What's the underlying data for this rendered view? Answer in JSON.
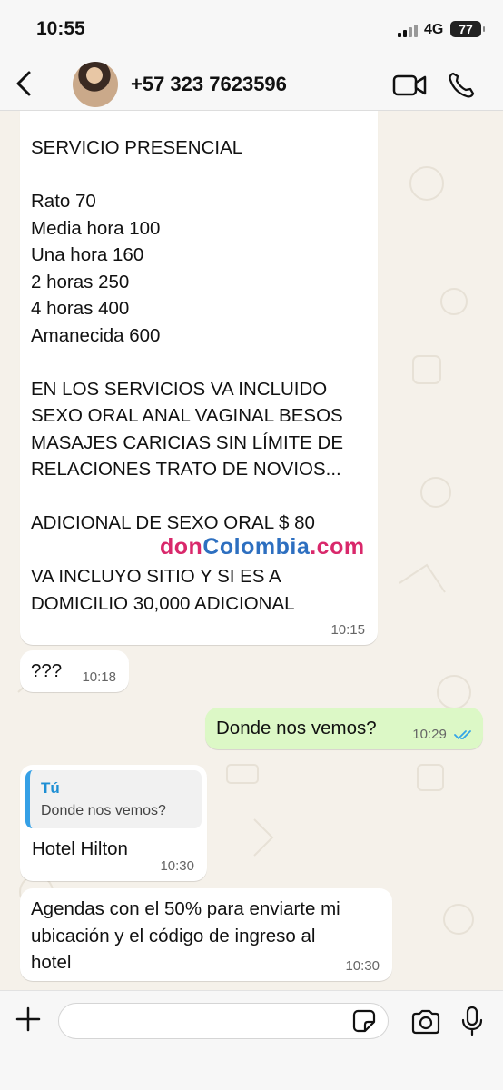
{
  "status": {
    "time": "10:55",
    "network": "4G",
    "battery": "77"
  },
  "header": {
    "contact": "+57 323 7623596"
  },
  "messages": [
    {
      "text": "SERVICIO PRESENCIAL\n\nRato 70\nMedia hora 100\nUna hora 160\n2 horas 250\n4 horas 400\nAmanecida 600\n\nEN LOS SERVICIOS VA INCLUIDO\nSEXO ORAL ANAL VAGINAL BESOS\nMASAJES CARICIAS SIN LÍMITE DE\nRELACIONES TRATO DE NOVIOS...\n\nADICIONAL DE SEXO ORAL $ 80\n\nVA INCLUYO SITIO Y SI ES A\nDOMICILIO 30,000 ADICIONAL",
      "time": "10:15"
    },
    {
      "text": "???",
      "time": "10:18"
    },
    {
      "text": "Donde nos vemos?",
      "time": "10:29"
    },
    {
      "reply_author": "Tú",
      "reply_text": "Donde nos vemos?",
      "text": "Hotel Hilton",
      "time": "10:30"
    },
    {
      "text": "Agendas con el 50% para enviarte mi\nubicación y el código de ingreso al\nhotel",
      "time": "10:30"
    }
  ],
  "watermark": {
    "part1": "don",
    "part2": "Colombia",
    "part3": ".com"
  },
  "colors": {
    "outgoing": "#dcf8c6",
    "incoming": "#ffffff",
    "accent": "#35a0e6",
    "ticks": "#34a4e8"
  },
  "icons": [
    "back-icon",
    "video-call-icon",
    "phone-icon",
    "plus-icon",
    "sticker-icon",
    "camera-icon",
    "mic-icon",
    "read-ticks-icon"
  ]
}
